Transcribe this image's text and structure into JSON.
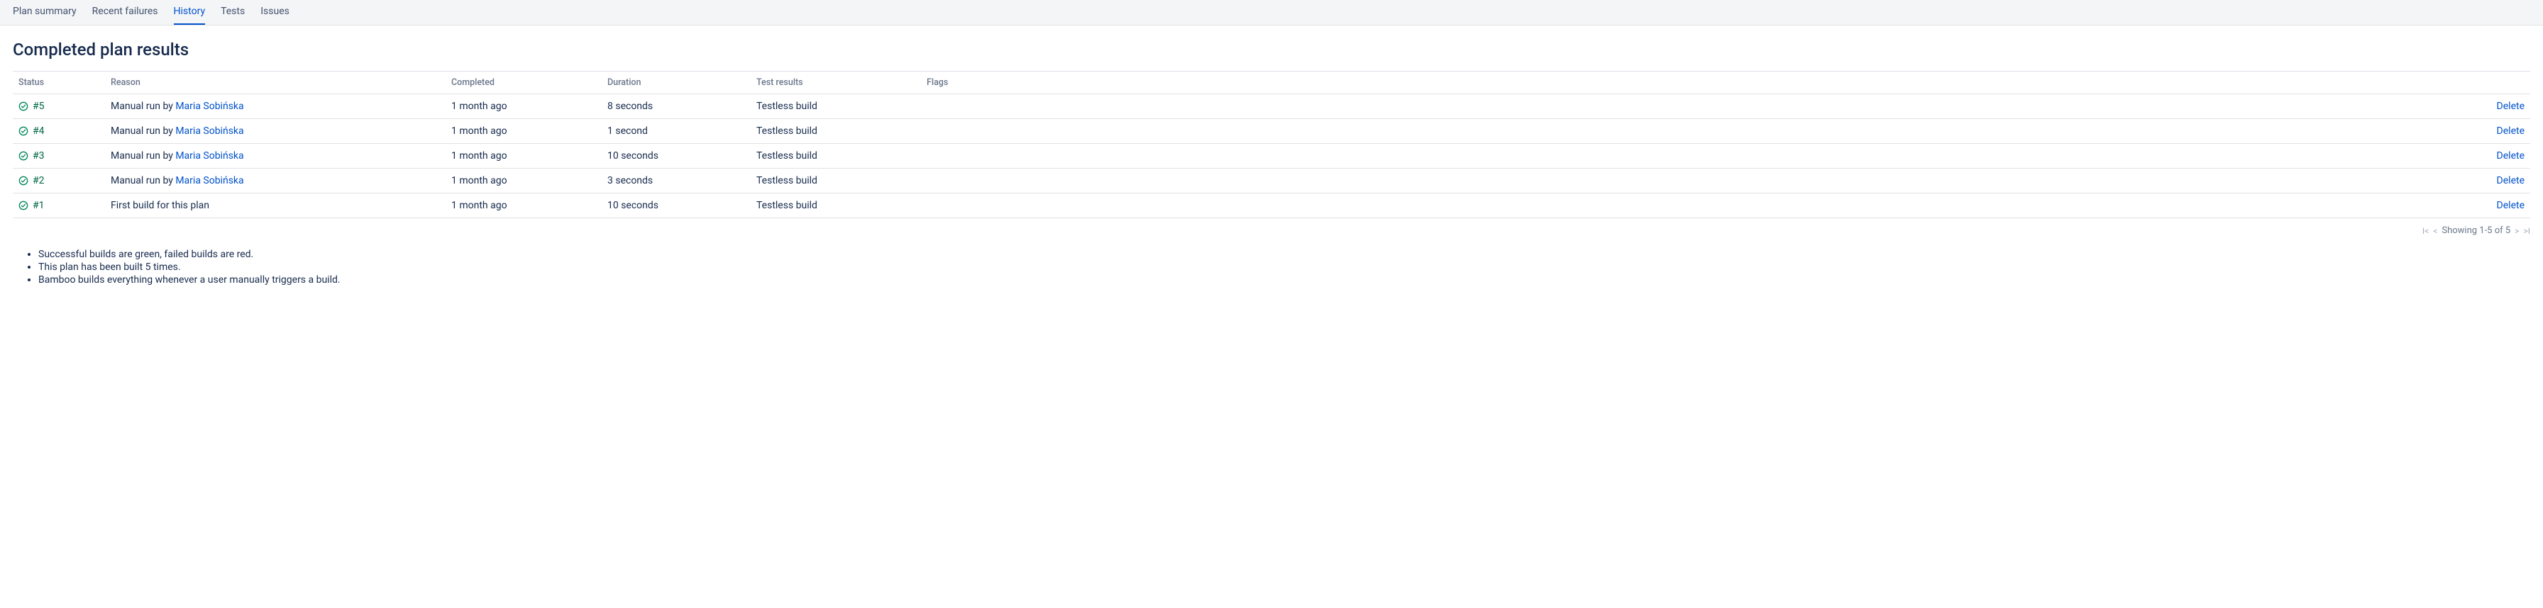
{
  "tabs": [
    {
      "label": "Plan summary",
      "active": false
    },
    {
      "label": "Recent failures",
      "active": false
    },
    {
      "label": "History",
      "active": true
    },
    {
      "label": "Tests",
      "active": false
    },
    {
      "label": "Issues",
      "active": false
    }
  ],
  "page_title": "Completed plan results",
  "columns": {
    "status": "Status",
    "reason": "Reason",
    "completed": "Completed",
    "duration": "Duration",
    "test_results": "Test results",
    "flags": "Flags"
  },
  "rows": [
    {
      "build": "#5",
      "reason_prefix": "Manual run by ",
      "reason_user": "Maria Sobińska",
      "completed": "1 month ago",
      "duration": "8 seconds",
      "test_results": "Testless build",
      "action": "Delete"
    },
    {
      "build": "#4",
      "reason_prefix": "Manual run by ",
      "reason_user": "Maria Sobińska",
      "completed": "1 month ago",
      "duration": "1 second",
      "test_results": "Testless build",
      "action": "Delete"
    },
    {
      "build": "#3",
      "reason_prefix": "Manual run by ",
      "reason_user": "Maria Sobińska",
      "completed": "1 month ago",
      "duration": "10 seconds",
      "test_results": "Testless build",
      "action": "Delete"
    },
    {
      "build": "#2",
      "reason_prefix": "Manual run by ",
      "reason_user": "Maria Sobińska",
      "completed": "1 month ago",
      "duration": "3 seconds",
      "test_results": "Testless build",
      "action": "Delete"
    },
    {
      "build": "#1",
      "reason_prefix": "First build for this plan",
      "reason_user": "",
      "completed": "1 month ago",
      "duration": "10 seconds",
      "test_results": "Testless build",
      "action": "Delete"
    }
  ],
  "pagination_text": "Showing 1-5 of 5",
  "notes": [
    "Successful builds are green, failed builds are red.",
    "This plan has been built 5 times.",
    "Bamboo builds everything whenever a user manually triggers a build."
  ]
}
